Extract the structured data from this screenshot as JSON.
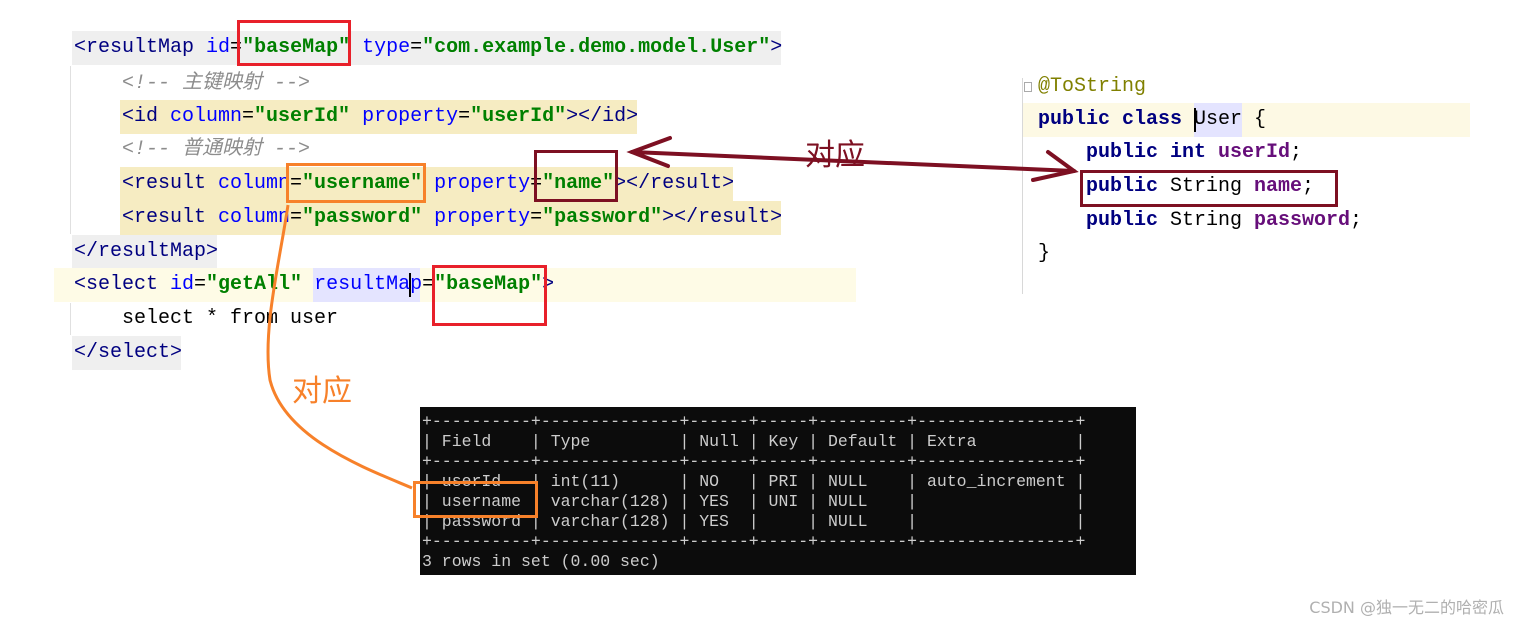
{
  "xml_editor": {
    "lines": [
      [
        [
          "<resultMap ",
          "tag"
        ],
        [
          "id",
          "attr"
        ],
        [
          "=",
          "plain"
        ],
        [
          "\"baseMap\"",
          "val"
        ],
        [
          " ",
          "plain"
        ],
        [
          "type",
          "attr"
        ],
        [
          "=",
          "plain"
        ],
        [
          "\"com.example.demo.model.User\"",
          "val"
        ],
        [
          ">",
          "tag"
        ]
      ],
      [
        [
          "<!-- 主键映射 -->",
          "cmt"
        ]
      ],
      [
        [
          "<id ",
          "tag"
        ],
        [
          "column",
          "attr"
        ],
        [
          "=",
          "plain"
        ],
        [
          "\"userId\"",
          "val"
        ],
        [
          " ",
          "plain"
        ],
        [
          "property",
          "attr"
        ],
        [
          "=",
          "plain"
        ],
        [
          "\"userId\"",
          "val"
        ],
        [
          "></id>",
          "tag"
        ]
      ],
      [
        [
          "<!-- 普通映射 -->",
          "cmt"
        ]
      ],
      [
        [
          "<result ",
          "tag"
        ],
        [
          "column",
          "attr"
        ],
        [
          "=",
          "plain"
        ],
        [
          "\"username\"",
          "val"
        ],
        [
          " ",
          "plain"
        ],
        [
          "property",
          "attr"
        ],
        [
          "=",
          "plain"
        ],
        [
          "\"name\"",
          "val"
        ],
        [
          "></result>",
          "tag"
        ]
      ],
      [
        [
          "<result ",
          "tag"
        ],
        [
          "column",
          "attr"
        ],
        [
          "=",
          "plain"
        ],
        [
          "\"password\"",
          "val"
        ],
        [
          " ",
          "plain"
        ],
        [
          "property",
          "attr"
        ],
        [
          "=",
          "plain"
        ],
        [
          "\"password\"",
          "val"
        ],
        [
          "></result>",
          "tag"
        ]
      ],
      [
        [
          "</resultMap>",
          "tag"
        ]
      ],
      [
        [
          "<select ",
          "tag"
        ],
        [
          "id",
          "attr"
        ],
        [
          "=",
          "plain"
        ],
        [
          "\"getAll\"",
          "val"
        ],
        [
          " ",
          "plain"
        ],
        [
          "resultMap",
          "attr"
        ],
        [
          "=",
          "plain"
        ],
        [
          "\"baseMap\"",
          "val"
        ],
        [
          ">",
          "tag"
        ]
      ],
      [
        [
          "select * from user",
          "plain"
        ]
      ],
      [
        [
          "</select>",
          "tag"
        ]
      ]
    ]
  },
  "java_editor": {
    "lines": [
      [
        [
          "@ToString",
          "ann"
        ]
      ],
      [
        [
          "public class ",
          "kw"
        ],
        [
          "User",
          "plain"
        ],
        [
          " {",
          "plain"
        ]
      ],
      [
        [
          "public int ",
          "kw"
        ],
        [
          "userId",
          "fld"
        ],
        [
          ";",
          "plain"
        ]
      ],
      [
        [
          "public ",
          "kw"
        ],
        [
          "String ",
          "plain"
        ],
        [
          "name",
          "fld"
        ],
        [
          ";",
          "plain"
        ]
      ],
      [
        [
          "public ",
          "kw"
        ],
        [
          "String ",
          "plain"
        ],
        [
          "password",
          "fld"
        ],
        [
          ";",
          "plain"
        ]
      ],
      [
        [
          "}",
          "plain"
        ]
      ]
    ]
  },
  "terminal": {
    "lines": [
      "+----------+--------------+------+-----+---------+----------------+",
      "| Field    | Type         | Null | Key | Default | Extra          |",
      "+----------+--------------+------+-----+---------+----------------+",
      "| userId   | int(11)      | NO   | PRI | NULL    | auto_increment |",
      "| username | varchar(128) | YES  | UNI | NULL    |                |",
      "| password | varchar(128) | YES  |     | NULL    |                |",
      "+----------+--------------+------+-----+---------+----------------+",
      "3 rows in set (0.00 sec)"
    ]
  },
  "annotations": {
    "label_right": "对应",
    "label_left": "对应",
    "colors": {
      "red": "#e8202a",
      "orange": "#f7812a",
      "dark_red": "#7d1022"
    }
  },
  "watermark": "CSDN @独一无二的哈密瓜"
}
